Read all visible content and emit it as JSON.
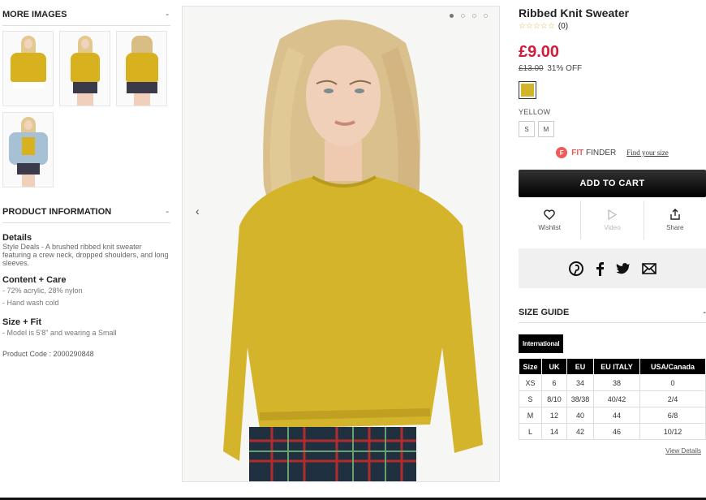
{
  "left": {
    "more_images_title": "MORE IMAGES",
    "more_images_toggle": "-",
    "product_info_title": "PRODUCT INFORMATION",
    "product_info_toggle": "-",
    "details": {
      "title": "Details",
      "text": "Style Deals - A brushed ribbed knit sweater featuring a crew neck, dropped shoulders, and long sleeves."
    },
    "content_care": {
      "title": "Content + Care",
      "lines": [
        "- 72% acrylic, 28% nylon",
        "- Hand wash cold"
      ]
    },
    "size_fit": {
      "title": "Size + Fit",
      "lines": [
        "- Model is 5'8\" and wearing a Small"
      ]
    },
    "product_code": "Product Code : 2000290848"
  },
  "main_image": {
    "dots_count": 4,
    "active_dot": 0,
    "prev_arrow": "‹",
    "next_arrow": "›"
  },
  "product": {
    "title": "Ribbed Knit Sweater",
    "stars": "☆☆☆☆☆",
    "review_count": "(0)",
    "price": "£9.00",
    "original_price": "£13.00",
    "discount": "31% OFF",
    "swatch_color": "#d4b42a",
    "color_name": "YELLOW",
    "sizes": [
      "S",
      "M"
    ],
    "fit_finder": {
      "icon": "F",
      "brand_fit": "FIT",
      "brand_finder": " FINDER",
      "link": "Find your size"
    },
    "add_to_cart": "ADD TO CART",
    "actions": {
      "wishlist": "Wishlist",
      "video": "Video",
      "share": "Share"
    }
  },
  "size_guide": {
    "title": "SIZE GUIDE",
    "toggle": "-",
    "tab": "International",
    "headers": [
      "Size",
      "UK",
      "EU",
      "EU ITALY",
      "USA/Canada"
    ],
    "rows": [
      [
        "XS",
        "6",
        "34",
        "38",
        "0"
      ],
      [
        "S",
        "8/10",
        "38/38",
        "40/42",
        "2/4"
      ],
      [
        "M",
        "12",
        "40",
        "44",
        "6/8"
      ],
      [
        "L",
        "14",
        "42",
        "46",
        "10/12"
      ]
    ],
    "view_details": "View Details"
  },
  "colors": {
    "price_red": "#d21c3b",
    "sweater_yellow": "#d4b42a",
    "fit_red": "#ef5a5a"
  }
}
